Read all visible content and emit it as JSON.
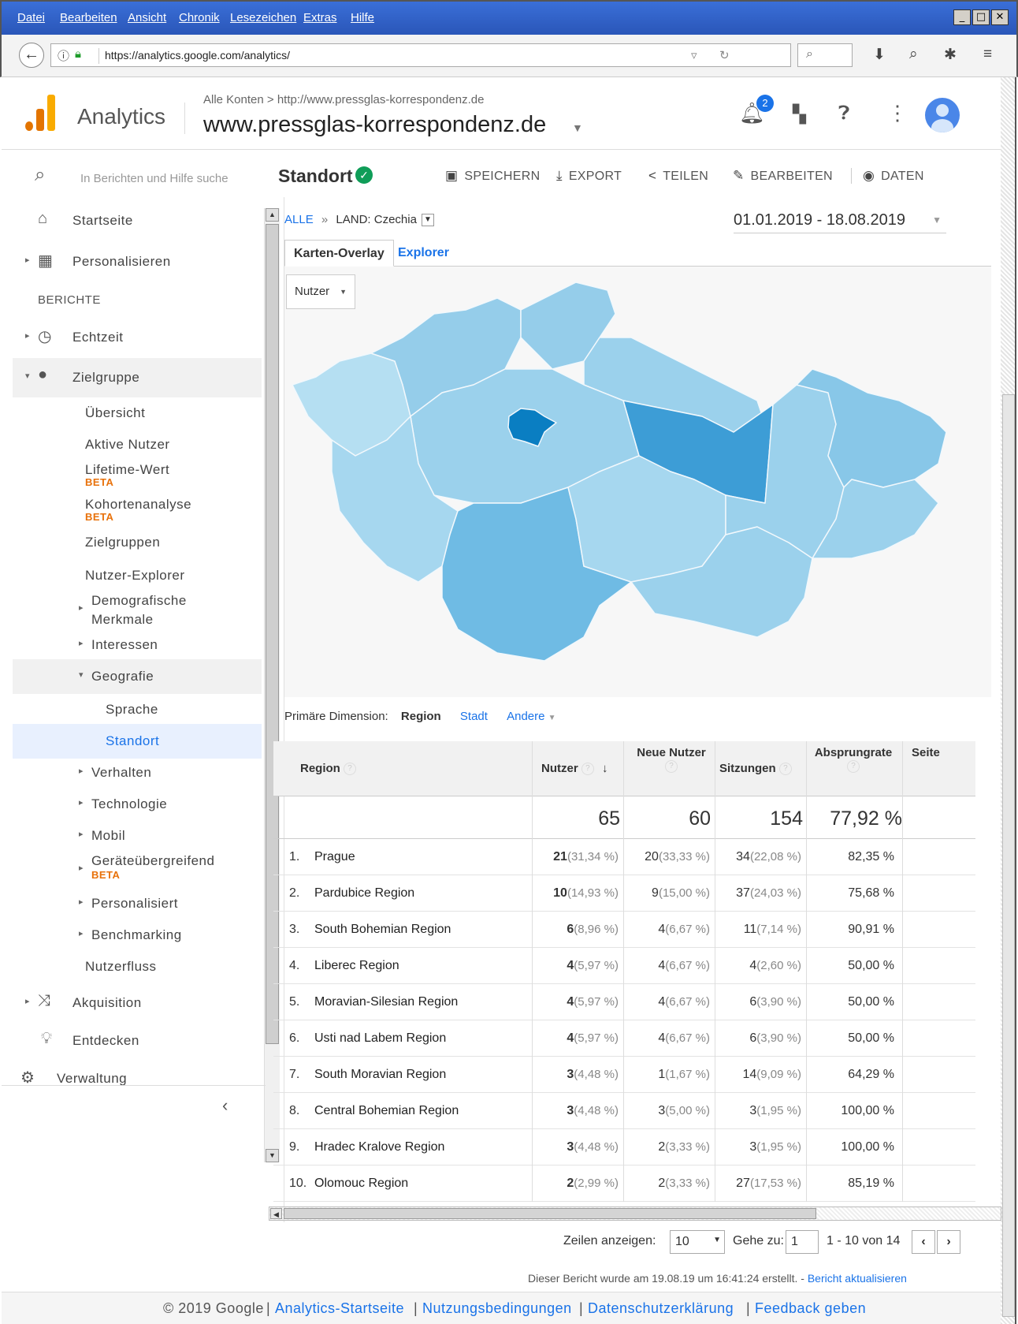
{
  "browser": {
    "menu": [
      "Datei",
      "Bearbeiten",
      "Ansicht",
      "Chronik",
      "Lesezeichen",
      "Extras",
      "Hilfe"
    ],
    "url": "https://analytics.google.com/analytics/"
  },
  "header": {
    "product": "Analytics",
    "breadcrumb": "Alle Konten > http://www.pressglas-korrespondenz.de",
    "property": "www.pressglas-korrespondenz.de",
    "notification_count": "2"
  },
  "sidebar": {
    "search_placeholder": "In Berichten und Hilfe suche",
    "section_label": "BERICHTE",
    "items": {
      "startseite": "Startseite",
      "personalisieren": "Personalisieren",
      "echtzeit": "Echtzeit",
      "zielgruppe": "Zielgruppe",
      "uebersicht": "Übersicht",
      "aktive_nutzer": "Aktive Nutzer",
      "lifetime": "Lifetime-Wert",
      "kohorten": "Kohortenanalyse",
      "zielgruppen": "Zielgruppen",
      "nutzer_explorer": "Nutzer-Explorer",
      "demografisch_1": "Demografische",
      "demografisch_2": "Merkmale",
      "interessen": "Interessen",
      "geografie": "Geografie",
      "sprache": "Sprache",
      "standort": "Standort",
      "verhalten": "Verhalten",
      "technologie": "Technologie",
      "mobil": "Mobil",
      "geraete": "Geräteübergreifend",
      "personalisiert": "Personalisiert",
      "benchmarking": "Benchmarking",
      "nutzerfluss": "Nutzerfluss",
      "akquisition": "Akquisition",
      "entdecken": "Entdecken",
      "verwaltung": "Verwaltung"
    },
    "beta_label": "BETA"
  },
  "report": {
    "title": "Standort",
    "actions": {
      "save": "SPEICHERN",
      "export": "EXPORT",
      "share": "TEILEN",
      "edit": "BEARBEITEN",
      "data": "DATEN"
    },
    "crumb_all": "ALLE",
    "crumb_sep": "»",
    "crumb_country": "LAND: Czechia",
    "date_range": "01.01.2019 - 18.08.2019",
    "tabs": [
      "Karten-Overlay",
      "Explorer"
    ],
    "map_metric": "Nutzer",
    "primary_dimension_label": "Primäre Dimension:",
    "dimensions": [
      "Region",
      "Stadt",
      "Andere"
    ]
  },
  "table": {
    "columns": [
      "Region",
      "Nutzer",
      "Neue Nutzer",
      "Sitzungen",
      "Absprungrate",
      "Seite"
    ],
    "totals": [
      "65",
      "60",
      "154",
      "77,92 %"
    ],
    "rows": [
      {
        "idx": "1.",
        "region": "Prague",
        "users": "21",
        "users_pct": "(31,34 %)",
        "new": "20",
        "new_pct": "(33,33 %)",
        "sessions": "34",
        "sessions_pct": "(22,08 %)",
        "bounce": "82,35 %"
      },
      {
        "idx": "2.",
        "region": "Pardubice Region",
        "users": "10",
        "users_pct": "(14,93 %)",
        "new": "9",
        "new_pct": "(15,00 %)",
        "sessions": "37",
        "sessions_pct": "(24,03 %)",
        "bounce": "75,68 %"
      },
      {
        "idx": "3.",
        "region": "South Bohemian Region",
        "users": "6",
        "users_pct": "(8,96 %)",
        "new": "4",
        "new_pct": "(6,67 %)",
        "sessions": "11",
        "sessions_pct": "(7,14 %)",
        "bounce": "90,91 %"
      },
      {
        "idx": "4.",
        "region": "Liberec Region",
        "users": "4",
        "users_pct": "(5,97 %)",
        "new": "4",
        "new_pct": "(6,67 %)",
        "sessions": "4",
        "sessions_pct": "(2,60 %)",
        "bounce": "50,00 %"
      },
      {
        "idx": "5.",
        "region": "Moravian-Silesian Region",
        "users": "4",
        "users_pct": "(5,97 %)",
        "new": "4",
        "new_pct": "(6,67 %)",
        "sessions": "6",
        "sessions_pct": "(3,90 %)",
        "bounce": "50,00 %"
      },
      {
        "idx": "6.",
        "region": "Usti nad Labem Region",
        "users": "4",
        "users_pct": "(5,97 %)",
        "new": "4",
        "new_pct": "(6,67 %)",
        "sessions": "6",
        "sessions_pct": "(3,90 %)",
        "bounce": "50,00 %"
      },
      {
        "idx": "7.",
        "region": "South Moravian Region",
        "users": "3",
        "users_pct": "(4,48 %)",
        "new": "1",
        "new_pct": "(1,67 %)",
        "sessions": "14",
        "sessions_pct": "(9,09 %)",
        "bounce": "64,29 %"
      },
      {
        "idx": "8.",
        "region": "Central Bohemian Region",
        "users": "3",
        "users_pct": "(4,48 %)",
        "new": "3",
        "new_pct": "(5,00 %)",
        "sessions": "3",
        "sessions_pct": "(1,95 %)",
        "bounce": "100,00 %"
      },
      {
        "idx": "9.",
        "region": "Hradec Kralove Region",
        "users": "3",
        "users_pct": "(4,48 %)",
        "new": "2",
        "new_pct": "(3,33 %)",
        "sessions": "3",
        "sessions_pct": "(1,95 %)",
        "bounce": "100,00 %"
      },
      {
        "idx": "10.",
        "region": "Olomouc Region",
        "users": "2",
        "users_pct": "(2,99 %)",
        "new": "2",
        "new_pct": "(3,33 %)",
        "sessions": "27",
        "sessions_pct": "(17,53 %)",
        "bounce": "85,19 %"
      }
    ]
  },
  "pager": {
    "rows_label": "Zeilen anzeigen:",
    "rows_value": "10",
    "goto_label": "Gehe zu:",
    "goto_value": "1",
    "range": "1 - 10 von 14"
  },
  "generated": {
    "text": "Dieser Bericht wurde am 19.08.19 um 16:41:24 erstellt. -",
    "refresh": "Bericht aktualisieren"
  },
  "footer": {
    "copyright": "© 2019 Google",
    "sep": "|",
    "links": [
      "Analytics-Startseite",
      "Nutzungsbedingungen",
      "Datenschutzerklärung",
      "Feedback geben"
    ]
  },
  "colors": {
    "accent": "#1a73e8",
    "map_light": "#9fd4ee",
    "map_mid": "#5fb3e0",
    "map_dark": "#2c8fd0",
    "map_darkest": "#0a7ec2"
  }
}
